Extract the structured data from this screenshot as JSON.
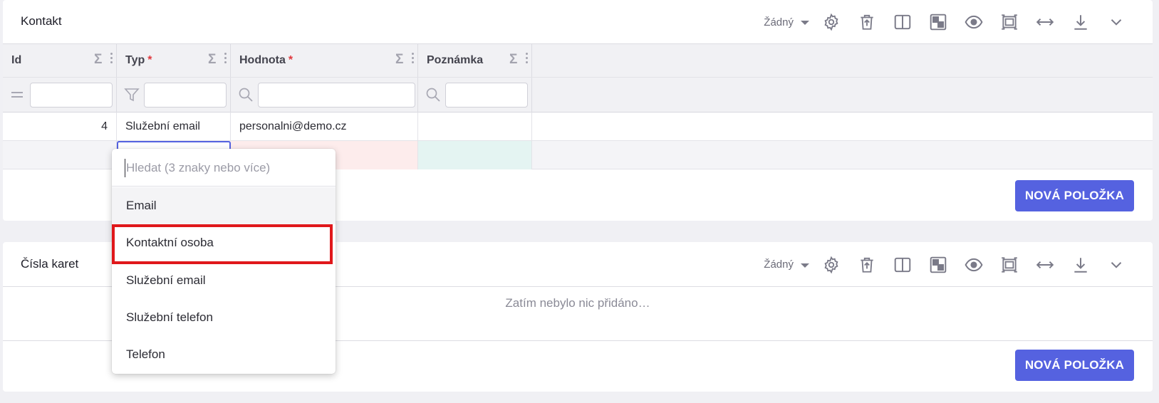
{
  "contact_panel": {
    "title": "Kontakt",
    "mode_label": "Žádný",
    "columns": [
      {
        "label": "Id",
        "required": false
      },
      {
        "label": "Typ",
        "required": true
      },
      {
        "label": "Hodnota",
        "required": true
      },
      {
        "label": "Poznámka",
        "required": false
      }
    ],
    "required_mark": "*",
    "sigma": "Σ",
    "rows": [
      {
        "id": "4",
        "typ": "Služební email",
        "hodnota": "personalni@demo.cz",
        "poznamka": ""
      }
    ],
    "new_button": "NOVÁ POLOŽKA"
  },
  "cards_panel": {
    "title": "Čísla karet",
    "mode_label": "Žádný",
    "empty_message": "Zatím nebylo nic přidáno…",
    "new_button": "NOVÁ POLOŽKA"
  },
  "type_dropdown": {
    "search_placeholder": "Hledat (3 znaky nebo více)",
    "search_value": "",
    "options": [
      "Email",
      "Kontaktní osoba",
      "Služební email",
      "Služební telefon",
      "Telefon"
    ],
    "active_option": "Email",
    "highlighted_option": "Kontaktní osoba"
  },
  "toolbar_icons": [
    "gear-icon",
    "trash-upload-icon",
    "columns-icon",
    "checker-icon",
    "eye-icon",
    "frame-icon",
    "horizontal-arrows-icon",
    "download-icon",
    "chevron-down-icon"
  ],
  "colors": {
    "accent": "#5562e0",
    "required": "#e0393e",
    "highlight_border": "#e0181b",
    "invalid_cell": "#fdecec",
    "valid_cell": "#e4f4f2"
  }
}
